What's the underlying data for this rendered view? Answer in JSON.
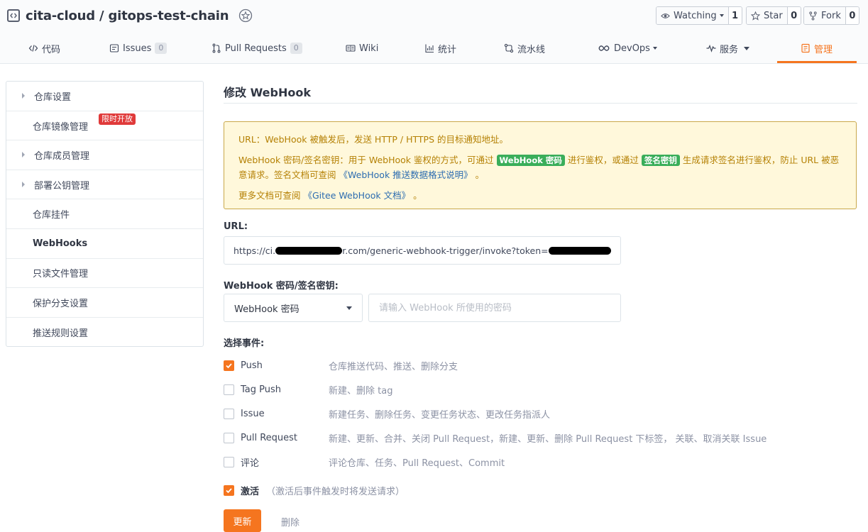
{
  "repo": {
    "name": "cita-cloud / gitops-test-chain",
    "watching_label": "Watching",
    "watching_count": "1",
    "star_label": "Star",
    "star_count": "0",
    "fork_label": "Fork",
    "fork_count": "0"
  },
  "tabs": [
    {
      "label": "代码",
      "icon": "code-icon"
    },
    {
      "label": "Issues",
      "count": "0",
      "icon": "issues-icon"
    },
    {
      "label": "Pull Requests",
      "count": "0",
      "icon": "pull-request-icon"
    },
    {
      "label": "Wiki",
      "icon": "wiki-icon"
    },
    {
      "label": "统计",
      "icon": "chart-icon"
    },
    {
      "label": "流水线",
      "icon": "pipeline-icon"
    },
    {
      "label": "DevOps",
      "icon": "infinity-icon"
    },
    {
      "label": "服务",
      "icon": "pulse-icon"
    },
    {
      "label": "管理",
      "icon": "manage-icon",
      "active": true
    }
  ],
  "sidebar": {
    "items": [
      {
        "label": "仓库设置"
      },
      {
        "label": "仓库镜像管理",
        "badge": "限时开放"
      },
      {
        "label": "仓库成员管理"
      },
      {
        "label": "部署公钥管理"
      },
      {
        "label": "仓库挂件"
      },
      {
        "label": "WebHooks"
      },
      {
        "label": "只读文件管理"
      },
      {
        "label": "保护分支设置"
      },
      {
        "label": "推送规则设置"
      }
    ]
  },
  "main": {
    "title": "修改 WebHook",
    "notice": {
      "line1": "URL：WebHook 被触发后，发送 HTTP / HTTPS 的目标通知地址。",
      "line2_a": "WebHook 密码/签名密钥：用于 WebHook 鉴权的方式，可通过",
      "tag1": "WebHook 密码",
      "line2_b": "进行鉴权，或通过",
      "tag2": "签名密钥",
      "line2_c": "生成请求签名进行鉴权，防止 URL 被恶意请求。签名文档可查阅",
      "link1": "《WebHook 推送数据格式说明》",
      "line2_d": "。",
      "line3_a": "更多文档可查阅",
      "link2": "《Gitee WebHook 文档》",
      "line3_b": "。"
    },
    "url_label": "URL:",
    "url_prefix": "https://ci.",
    "url_middle": "r.com/generic-webhook-trigger/invoke?token=",
    "secret_label": "WebHook 密码/签名密钥:",
    "secret_type": "WebHook 密码",
    "secret_placeholder": "请输入 WebHook 所使用的密码",
    "events_label": "选择事件:",
    "events": [
      {
        "name": "Push",
        "desc": "仓库推送代码、推送、删除分支",
        "checked": true
      },
      {
        "name": "Tag Push",
        "desc": "新建、删除 tag",
        "checked": false
      },
      {
        "name": "Issue",
        "desc": "新建任务、删除任务、变更任务状态、更改任务指派人",
        "checked": false
      },
      {
        "name": "Pull Request",
        "desc": "新建、更新、合并、关闭 Pull Request，新建、更新、删除 Pull Request 下标签， 关联、取消关联 Issue",
        "checked": false
      },
      {
        "name": "评论",
        "desc": "评论仓库、任务、Pull Request、Commit",
        "checked": false
      }
    ],
    "active_label": "激活",
    "active_hint": "（激活后事件触发时将发送请求）",
    "active_checked": true,
    "update_label": "更新",
    "delete_label": "删除"
  },
  "colors": {
    "accent": "#f5751f",
    "notice_bg": "#fff8db",
    "notice_text": "#b58105",
    "green_tag": "#3aae5a",
    "badge_red": "#e03a3a"
  }
}
